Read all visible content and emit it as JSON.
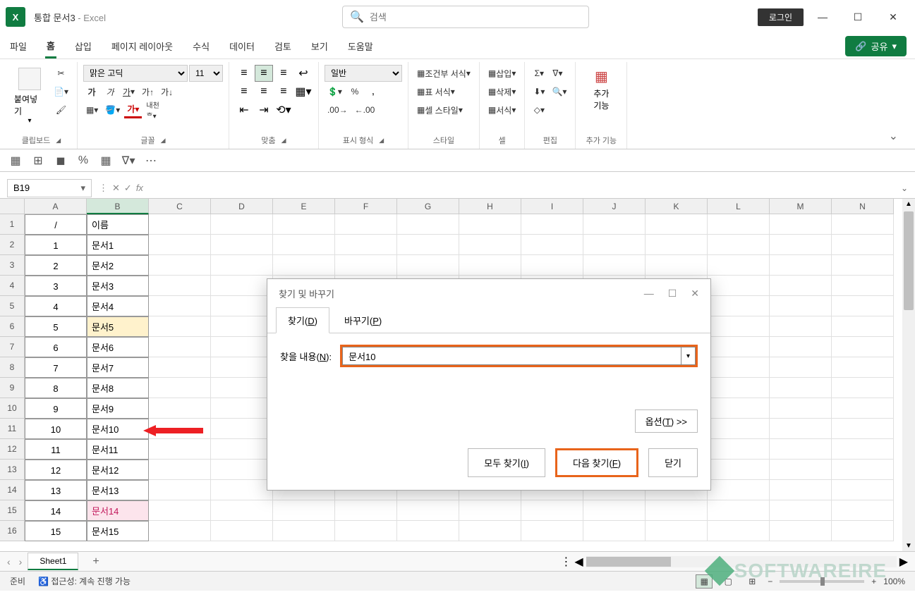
{
  "title": {
    "doc": "통합 문서3",
    "sep": "  -  ",
    "app": "Excel"
  },
  "search_placeholder": "검색",
  "login_label": "로그인",
  "tabs": [
    "파일",
    "홈",
    "삽입",
    "페이지 레이아웃",
    "수식",
    "데이터",
    "검토",
    "보기",
    "도움말"
  ],
  "active_tab_index": 1,
  "share_label": "공유",
  "ribbon": {
    "clipboard": {
      "paste": "붙여넣기",
      "label": "클립보드"
    },
    "font": {
      "name": "맑은 고딕",
      "size": "11",
      "label": "글꼴"
    },
    "align": {
      "label": "맞춤"
    },
    "number": {
      "format": "일반",
      "label": "표시 형식"
    },
    "styles": {
      "cond": "조건부 서식",
      "table": "표 서식",
      "cell": "셀 스타일",
      "label": "스타일"
    },
    "cells": {
      "insert": "삽입",
      "delete": "삭제",
      "format": "서식",
      "label": "셀"
    },
    "editing": {
      "label": "편집"
    },
    "addins": {
      "btn": "추가\n기능",
      "label": "추가 기능"
    }
  },
  "name_box": "B19",
  "columns": [
    "A",
    "B",
    "C",
    "D",
    "E",
    "F",
    "G",
    "H",
    "I",
    "J",
    "K",
    "L",
    "M",
    "N"
  ],
  "rows": [
    {
      "n": 1,
      "a": "/",
      "b": "이름"
    },
    {
      "n": 2,
      "a": "1",
      "b": "문서1"
    },
    {
      "n": 3,
      "a": "2",
      "b": "문서2"
    },
    {
      "n": 4,
      "a": "3",
      "b": "문서3"
    },
    {
      "n": 5,
      "a": "4",
      "b": "문서4"
    },
    {
      "n": 6,
      "a": "5",
      "b": "문서5"
    },
    {
      "n": 7,
      "a": "6",
      "b": "문서6"
    },
    {
      "n": 8,
      "a": "7",
      "b": "문서7"
    },
    {
      "n": 9,
      "a": "8",
      "b": "문서8"
    },
    {
      "n": 10,
      "a": "9",
      "b": "문서9"
    },
    {
      "n": 11,
      "a": "10",
      "b": "문서10"
    },
    {
      "n": 12,
      "a": "11",
      "b": "문서11"
    },
    {
      "n": 13,
      "a": "12",
      "b": "문서12"
    },
    {
      "n": 14,
      "a": "13",
      "b": "문서13"
    },
    {
      "n": 15,
      "a": "14",
      "b": "문서14"
    },
    {
      "n": 16,
      "a": "15",
      "b": "문서15"
    }
  ],
  "highlight_yellow_row": 6,
  "highlight_pink_row": 15,
  "sheet_tab": "Sheet1",
  "status": {
    "ready": "준비",
    "access": "접근성: 계속 진행 가능",
    "zoom": "100%"
  },
  "dialog": {
    "title": "찾기 및 바꾸기",
    "tab_find": "찾기(D)",
    "tab_replace": "바꾸기(P)",
    "find_label": "찾을 내용(N):",
    "find_value": "문서10",
    "options": "옵션(T) >>",
    "find_all": "모두 찾기(I)",
    "find_next": "다음 찾기(F)",
    "close": "닫기"
  },
  "watermark": "SOFTWAREIRE"
}
